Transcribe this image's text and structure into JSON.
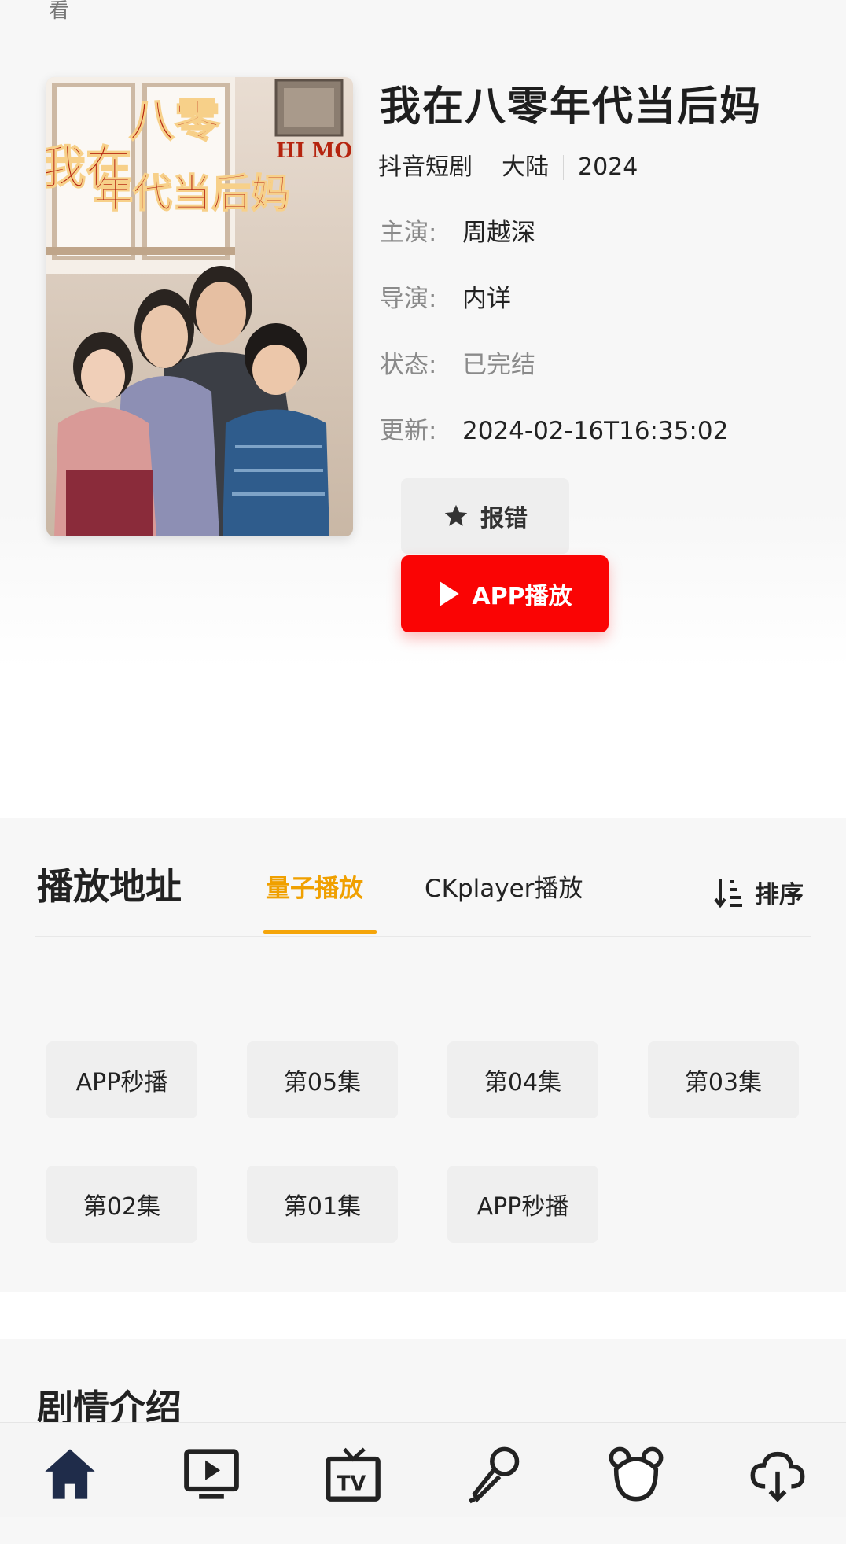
{
  "top_fragment": "看",
  "poster": {
    "line1": "八零",
    "line2": "我在",
    "line3": "年代当后妈",
    "tag": "HI MO"
  },
  "detail": {
    "title": "我在八零年代当后妈",
    "category": "抖音短剧",
    "region": "大陆",
    "year": "2024",
    "cast_label": "主演:",
    "cast": "周越深",
    "director_label": "导演:",
    "director": "内详",
    "status_label": "状态:",
    "status": "已完结",
    "update_label": "更新:",
    "update": "2024-02-16T16:35:02"
  },
  "buttons": {
    "report": "报错",
    "app_play": "APP播放"
  },
  "playlist": {
    "section_title": "播放地址",
    "tabs": [
      "量子播放",
      "CKplayer播放"
    ],
    "active_tab": 0,
    "sort_label": "排序",
    "episodes": [
      "APP秒播",
      "第05集",
      "第04集",
      "第03集",
      "第02集",
      "第01集",
      "APP秒播"
    ]
  },
  "plot": {
    "section_title": "剧情介绍"
  },
  "bottom_nav": {
    "items": [
      "home-icon",
      "video-icon",
      "tv-icon",
      "microphone-icon",
      "bear-icon",
      "download-icon"
    ]
  },
  "colors": {
    "accent": "#f0a000",
    "play_button": "#fa0404",
    "background": "#f7f7f7",
    "nav_icon": "#1f2c4a"
  }
}
